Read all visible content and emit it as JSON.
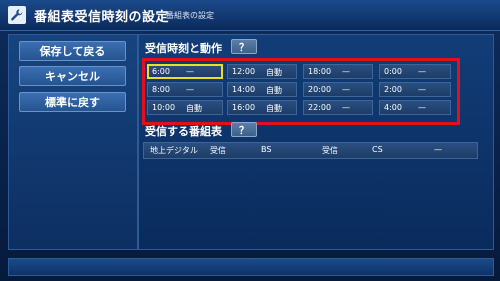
{
  "header": {
    "title": "番組表受信時刻の設定",
    "subtitle": "番組表の設定",
    "icon": "wrench-icon"
  },
  "menu": {
    "save_return": "保存して戻る",
    "cancel": "キャンセル",
    "restore_default": "標準に戻す"
  },
  "schedule": {
    "title": "受信時刻と動作",
    "help": "？",
    "rows": [
      [
        {
          "time": "6:00",
          "action": "—"
        },
        {
          "time": "12:00",
          "action": "自動"
        },
        {
          "time": "18:00",
          "action": "—"
        },
        {
          "time": "0:00",
          "action": "—"
        }
      ],
      [
        {
          "time": "8:00",
          "action": "—"
        },
        {
          "time": "14:00",
          "action": "自動"
        },
        {
          "time": "20:00",
          "action": "—"
        },
        {
          "time": "2:00",
          "action": "—"
        }
      ],
      [
        {
          "time": "10:00",
          "action": "自動"
        },
        {
          "time": "16:00",
          "action": "自動"
        },
        {
          "time": "22:00",
          "action": "—"
        },
        {
          "time": "4:00",
          "action": "—"
        }
      ]
    ]
  },
  "receive": {
    "title": "受信する番組表",
    "help": "？",
    "terrestrial_label": "地上デジタル",
    "terrestrial_value": "受信",
    "bs_label": "BS",
    "bs_value": "受信",
    "cs_label": "CS",
    "cs_value": "—"
  },
  "colors": {
    "focus": "#e8e020",
    "highlight_frame": "#e2101a"
  }
}
